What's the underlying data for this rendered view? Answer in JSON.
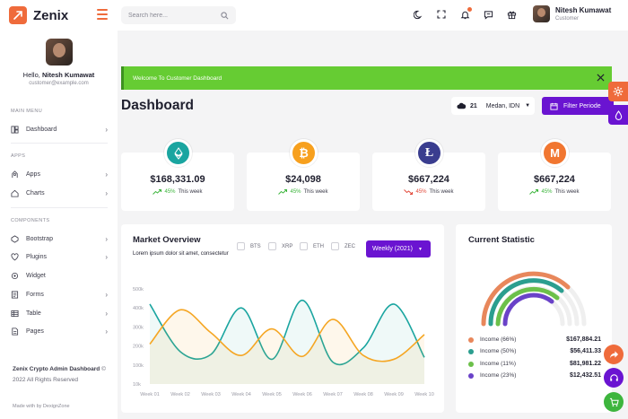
{
  "brand": {
    "name": "Zenix",
    "accent": "#ef6b3b"
  },
  "header": {
    "search_placeholder": "Search here...",
    "user_name": "Nitesh Kumawat",
    "user_role": "Customer"
  },
  "sidebar": {
    "hello_prefix": "Hello,",
    "user_name": "Nitesh Kumawat",
    "email": "customer@example.com",
    "sections": {
      "main_menu": "MAIN MENU",
      "apps": "APPS",
      "components": "COMPONENTS"
    },
    "items": [
      {
        "label": "Dashboard",
        "icon": "dashboard-icon"
      },
      {
        "label": "Apps",
        "icon": "apps-icon"
      },
      {
        "label": "Charts",
        "icon": "charts-icon"
      },
      {
        "label": "Bootstrap",
        "icon": "bootstrap-icon"
      },
      {
        "label": "Plugins",
        "icon": "plugins-icon"
      },
      {
        "label": "Widget",
        "icon": "widget-icon"
      },
      {
        "label": "Forms",
        "icon": "forms-icon"
      },
      {
        "label": "Table",
        "icon": "table-icon"
      },
      {
        "label": "Pages",
        "icon": "pages-icon"
      }
    ],
    "footer_title": "Zenix Crypto Admin Dashboard",
    "footer_copy": "© 2022 All Rights Reserved",
    "made_with": "Made with by DexignZone"
  },
  "banner": {
    "text": "Welcome To Customer Dashboard",
    "color": "#66cc33"
  },
  "page_title": "Dashboard",
  "weather": {
    "temp": "21",
    "city": "Medan, IDN"
  },
  "filter_button": "Filter Periode",
  "coins": [
    {
      "name": "Ethereum",
      "icon": "ethereum-icon",
      "color": "#1aa5a0",
      "value": "$168,331.09",
      "change": "45%",
      "change_label": "This week",
      "direction": "up"
    },
    {
      "name": "Bitcoin",
      "icon": "bitcoin-icon",
      "color": "#f7a01e",
      "value": "$24,098",
      "change": "45%",
      "change_label": "This week",
      "direction": "up"
    },
    {
      "name": "Litecoin",
      "icon": "litecoin-icon",
      "color": "#3a3d8f",
      "value": "$667,224",
      "change": "45%",
      "change_label": "This week",
      "direction": "down"
    },
    {
      "name": "Monero",
      "icon": "monero-icon",
      "color": "#f17630",
      "value": "$667,224",
      "change": "45%",
      "change_label": "This week",
      "direction": "up"
    }
  ],
  "market": {
    "title": "Market Overview",
    "subtitle": "Lorem ipsum dolor sit amet, consectetur",
    "legend": [
      "BTS",
      "XRP",
      "ETH",
      "ZEC"
    ],
    "period_button": "Weekly (2021)"
  },
  "chart_data": {
    "type": "line",
    "categories": [
      "Week 01",
      "Week 02",
      "Week 03",
      "Week 04",
      "Week 05",
      "Week 06",
      "Week 07",
      "Week 08",
      "Week 09",
      "Week 10"
    ],
    "y_tick_labels": [
      "500k",
      "400k",
      "300k",
      "200k",
      "100k",
      "10k"
    ],
    "ylim": [
      0,
      500
    ],
    "series": [
      {
        "color": "#1aa5a0",
        "values": [
          420,
          170,
          155,
          400,
          130,
          440,
          115,
          190,
          420,
          140
        ]
      },
      {
        "color": "#f5a623",
        "values": [
          210,
          390,
          270,
          150,
          290,
          145,
          340,
          150,
          130,
          260
        ]
      }
    ],
    "x": [],
    "grid": false
  },
  "statistic": {
    "title": "Current Statistic",
    "items": [
      {
        "label": "Income (66%)",
        "value": "$167,884.21",
        "color": "#e8875b",
        "pct": 66
      },
      {
        "label": "Income (50%)",
        "value": "$56,411.33",
        "color": "#2b9e8f",
        "pct": 50
      },
      {
        "label": "Income (11%)",
        "value": "$81,981.22",
        "color": "#6cc04a",
        "pct": 11
      },
      {
        "label": "Income (23%)",
        "value": "$12,432.51",
        "color": "#6a42c8",
        "pct": 23
      }
    ]
  }
}
